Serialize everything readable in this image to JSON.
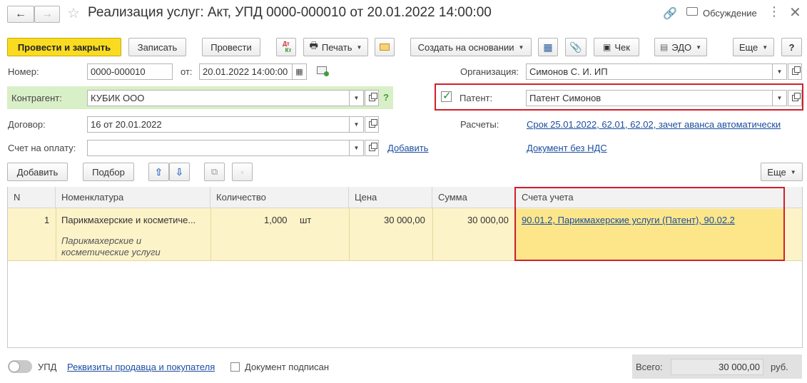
{
  "window": {
    "title": "Реализация услуг: Акт, УПД 0000-000010 от 20.01.2022 14:00:00",
    "discussion_label": "Обсуждение"
  },
  "toolbar": {
    "post_close_label": "Провести и закрыть",
    "save_label": "Записать",
    "post_label": "Провести",
    "print_label": "Печать",
    "create_based_label": "Создать на основании",
    "receipt_label": "Чек",
    "edo_label": "ЭДО",
    "more_label": "Еще",
    "help_label": "?",
    "dt_kt_top": "Дт",
    "dt_kt_bottom": "Кт"
  },
  "form": {
    "number_label": "Номер:",
    "number_value": "0000-000010",
    "date_label": "от:",
    "date_value": "20.01.2022 14:00:00",
    "org_label": "Организация:",
    "org_value": "Симонов С. И. ИП",
    "contractor_label": "Контрагент:",
    "contractor_value": "КУБИК ООО",
    "contractor_help": "?",
    "patent_label": "Патент:",
    "patent_value": "Патент Симонов",
    "patent_checked": true,
    "contract_label": "Договор:",
    "contract_value": "16 от 20.01.2022",
    "settlements_label": "Расчеты:",
    "settlements_link": "Срок 25.01.2022, 62.01, 62.02, зачет аванса автоматически",
    "invoice_label": "Счет на оплату:",
    "invoice_value": "",
    "invoice_add_link": "Добавить",
    "vat_link": "Документ без НДС"
  },
  "table_toolbar": {
    "add_label": "Добавить",
    "pick_label": "Подбор",
    "more_label": "Еще"
  },
  "table": {
    "columns": [
      "N",
      "Номенклатура",
      "Количество",
      "Цена",
      "Сумма",
      "Счета учета"
    ],
    "rows": [
      {
        "n": "1",
        "item": "Парикмахерские и косметиче...",
        "item_desc_line1": "Парикмахерские и",
        "item_desc_line2": "косметические услуги",
        "qty": "1,000",
        "unit": "шт",
        "price": "30 000,00",
        "sum": "30 000,00",
        "accounts": "90.01.2, Парикмахерские услуги (Патент), 90.02.2"
      }
    ]
  },
  "footer": {
    "upd_label": "УПД",
    "requisites_link": "Реквизиты продавца и покупателя",
    "signed_label": "Документ подписан",
    "total_label": "Всего:",
    "total_value": "30 000,00",
    "currency": "руб."
  },
  "colors": {
    "primary_button": "#f9dc22",
    "highlight_border": "#d0202a",
    "selected_row": "#fdf3c8",
    "accounts_cell": "#fde68a",
    "contractor_bg": "#d9efc7",
    "link": "#1b4ea0"
  }
}
